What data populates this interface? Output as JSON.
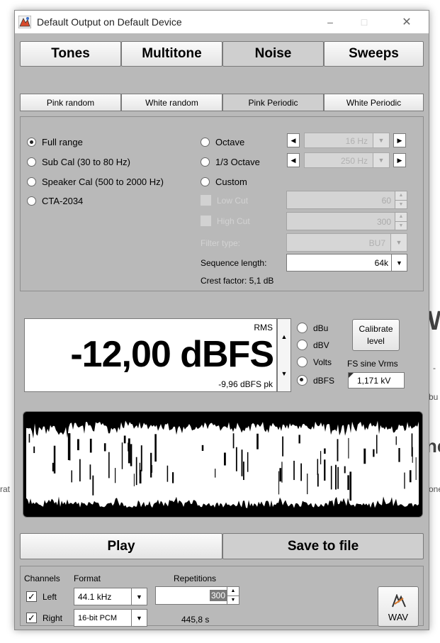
{
  "background": {
    "frag_right_big": "W",
    "frag_right_dash": "-",
    "frag_right_bu": "bu",
    "frag_right_ne": "ne",
    "frag_right_one": "one",
    "frag_left_rat": "rat"
  },
  "window": {
    "title": "Default Output on Default Device",
    "minimize_glyph": "–",
    "maximize_glyph": "□",
    "close_glyph": "✕"
  },
  "main_tabs": [
    "Tones",
    "Multitone",
    "Noise",
    "Sweeps"
  ],
  "main_tab_selected": "Noise",
  "sub_tabs": [
    "Pink random",
    "White random",
    "Pink Periodic",
    "White Periodic"
  ],
  "sub_tab_selected": "Pink Periodic",
  "range_options": [
    {
      "label": "Full range",
      "selected": true
    },
    {
      "label": "Sub Cal (30 to 80 Hz)",
      "selected": false
    },
    {
      "label": "Speaker Cal (500 to 2000 Hz)",
      "selected": false
    },
    {
      "label": "CTA-2034",
      "selected": false
    }
  ],
  "band_options": [
    {
      "label": "Octave",
      "selected": false,
      "combo": "16 Hz"
    },
    {
      "label": "1/3 Octave",
      "selected": false,
      "combo": "250 Hz"
    },
    {
      "label": "Custom",
      "selected": false
    }
  ],
  "filters": {
    "low_cut_label": "Low Cut",
    "low_cut_value": "60",
    "high_cut_label": "High Cut",
    "high_cut_value": "300",
    "filter_type_label": "Filter type:",
    "filter_type_value": "BU7"
  },
  "sequence": {
    "label": "Sequence length:",
    "value": "64k",
    "crest": "Crest factor: 5,1 dB"
  },
  "level": {
    "rms_label": "RMS",
    "value": "-12,00 dBFS",
    "peak": "-9,96 dBFS pk",
    "units": [
      {
        "label": "dBu",
        "selected": false
      },
      {
        "label": "dBV",
        "selected": false
      },
      {
        "label": "Volts",
        "selected": false
      },
      {
        "label": "dBFS",
        "selected": true
      }
    ],
    "calibrate_label": "Calibrate level",
    "fs_sine_label": "FS sine Vrms",
    "fs_sine_value": "1,171 kV"
  },
  "actions": {
    "play": "Play",
    "save": "Save to file"
  },
  "output": {
    "channels_label": "Channels",
    "format_label": "Format",
    "repetitions_label": "Repetitions",
    "left_label": "Left",
    "left_checked": true,
    "right_label": "Right",
    "right_checked": true,
    "sample_rate": "44.1 kHz",
    "bit_depth": "16-bit PCM",
    "repetitions_value": "300",
    "duration": "445,8 s",
    "wav_label": "WAV"
  },
  "colors": {
    "client_bg": "#b9b9b9",
    "waveform_bg": "#000000",
    "waveform_fg": "#ffffff"
  }
}
